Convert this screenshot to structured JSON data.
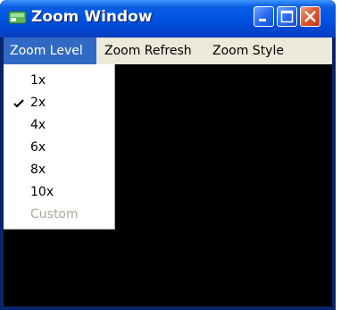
{
  "window": {
    "title": "Zoom Window",
    "controls": {
      "minimize": "minimize-icon",
      "maximize": "maximize-icon",
      "close": "close-icon"
    }
  },
  "menubar": {
    "items": [
      {
        "label": "Zoom Level",
        "active": true
      },
      {
        "label": "Zoom Refresh",
        "active": false
      },
      {
        "label": "Zoom Style",
        "active": false
      }
    ]
  },
  "zoom_menu": {
    "items": [
      {
        "label": "1x",
        "checked": false,
        "enabled": true
      },
      {
        "label": "2x",
        "checked": true,
        "enabled": true
      },
      {
        "label": "4x",
        "checked": false,
        "enabled": true
      },
      {
        "label": "6x",
        "checked": false,
        "enabled": true
      },
      {
        "label": "8x",
        "checked": false,
        "enabled": true
      },
      {
        "label": "10x",
        "checked": false,
        "enabled": true
      },
      {
        "label": "Custom",
        "checked": false,
        "enabled": false
      }
    ]
  },
  "colors": {
    "titlebar": "#0055e5",
    "menu_highlight": "#316ac5",
    "menubar_bg": "#ece9d8",
    "disabled_text": "#aca899",
    "canvas": "#000000"
  }
}
